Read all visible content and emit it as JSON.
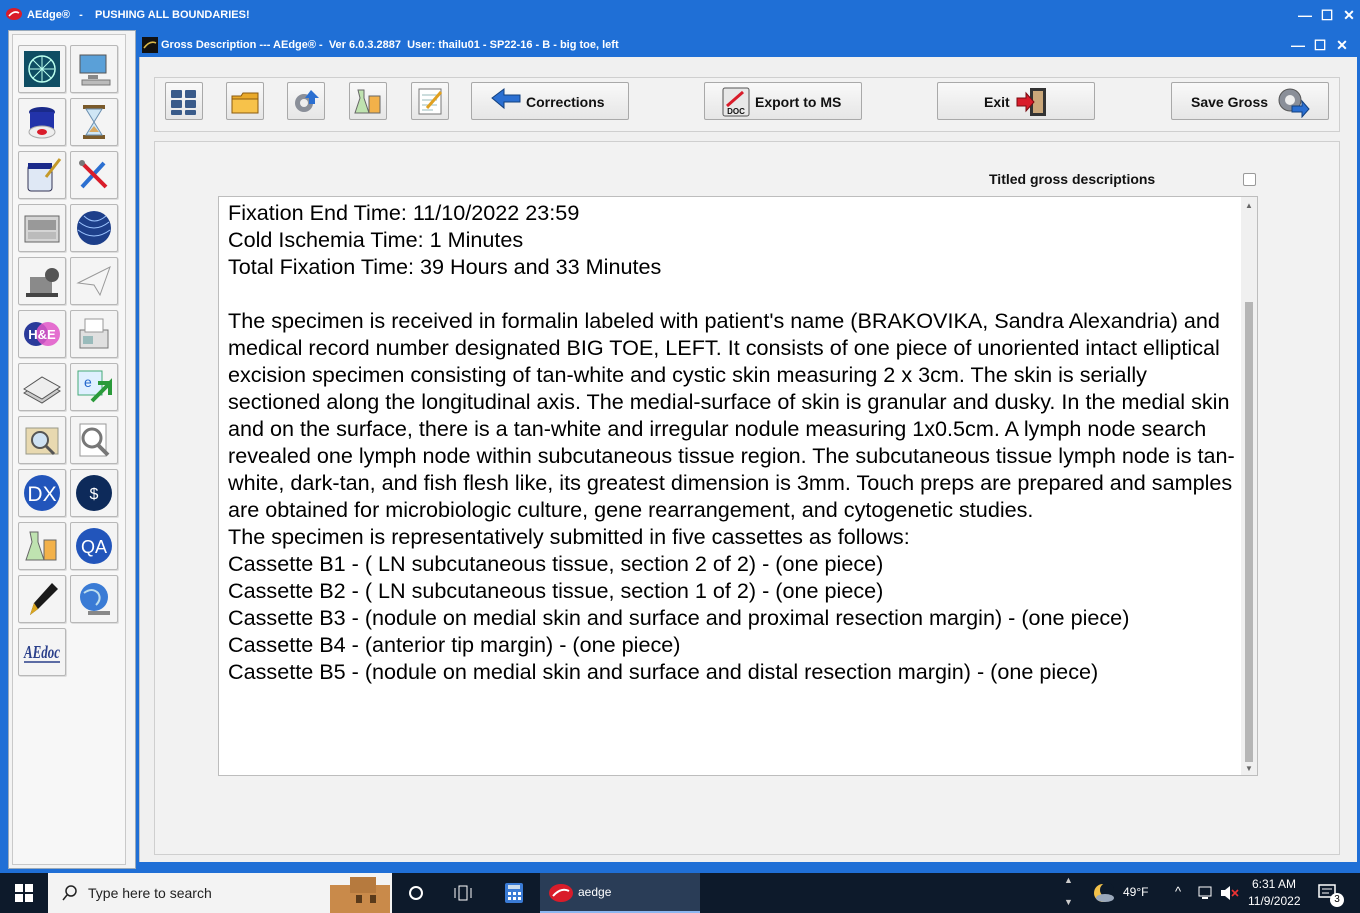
{
  "app": {
    "outer_title": "AEdge®   -    PUSHING ALL BOUNDARIES!",
    "inner_title": "Gross Description --- AEdge® -  Ver 6.0.3.2887  User: thailu01 - SP22-16 - B - big toe, left",
    "min_glyph": "—",
    "max_glyph": "☐",
    "close_glyph": "✕"
  },
  "toolbar": {
    "corrections_label": "Corrections",
    "export_label": "Export to MS",
    "exit_label": "Exit",
    "save_label": "Save Gross",
    "doc_label": "DOC"
  },
  "content": {
    "titled_label": "Titled gross descriptions",
    "titled_checked": false,
    "description": "Fixation End Time: 11/10/2022 23:59\nCold Ischemia Time: 1 Minutes\nTotal Fixation Time: 39 Hours and 33 Minutes\n\nThe specimen is received in formalin labeled with patient's name (BRAKOVIKA, Sandra Alexandria) and medical record number designated BIG TOE, LEFT. It consists of one piece of unoriented intact elliptical excision specimen consisting of tan-white and cystic skin measuring 2 x 3cm. The skin is serially sectioned along the longitudinal axis. The medial-surface of skin is granular and dusky. In the medial skin and on the surface, there is a tan-white and irregular nodule measuring 1x0.5cm. A lymph node search revealed one lymph node within subcutaneous tissue region. The subcutaneous tissue lymph node is tan-white, dark-tan, and fish flesh like, its greatest dimension is 3mm. Touch preps are prepared and samples are obtained for microbiologic culture, gene rearrangement, and cytogenetic studies.\nThe specimen is representatively submitted in five cassettes as follows:\nCassette B1 - ( LN subcutaneous tissue, section 2 of 2) - (one piece)\nCassette B2 - ( LN subcutaneous tissue, section 1 of 2) - (one piece)\nCassette B3 - (nodule on medial skin and surface and proximal resection margin) - (one piece)\nCassette B4 - (anterior tip margin) - (one piece)\nCassette B5 - (nodule on medial skin and surface and distal resection margin) - (one piece)"
  },
  "sidebar": {
    "tools": [
      "network-globe",
      "computer",
      "specimen-jar",
      "hourglass",
      "paint-jar",
      "tools",
      "tissue-processor",
      "sphere",
      "microtome",
      "paper-plane",
      "he-stain",
      "fax-machine",
      "slides-stack",
      "e-arrow",
      "magnifier-map",
      "magnifier-doc",
      "dx",
      "billing",
      "lab-flasks",
      "qa",
      "pen",
      "web-globe",
      "ae-doc"
    ],
    "dx_label": "DX",
    "qa_label": "QA",
    "he_label": "H&E",
    "ae_label": "AEdoc"
  },
  "taskbar": {
    "search_placeholder": "Type here to search",
    "aedge_label": "aedge",
    "weather": "49°F",
    "time": "6:31 AM",
    "date": "11/9/2022",
    "notification_count": "3"
  },
  "colors": {
    "title_blue": "#1f6fd6",
    "taskbar": "#0d1a2b",
    "panel_bg": "#f0f0f0"
  }
}
